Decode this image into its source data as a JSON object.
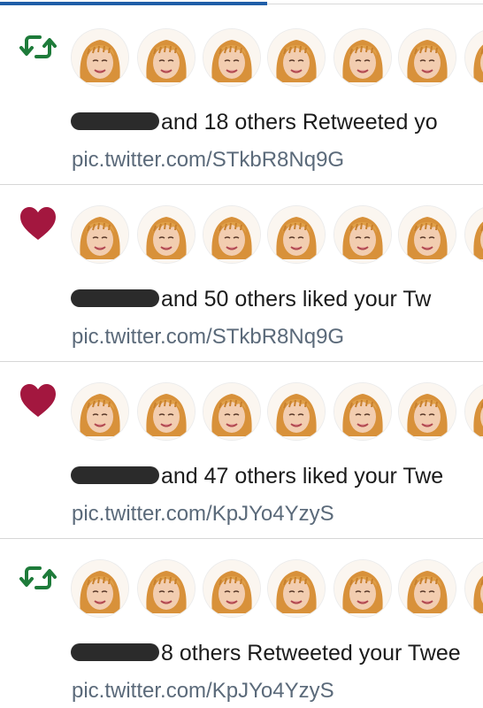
{
  "notifications": [
    {
      "type": "retweet",
      "icon": "retweet-icon",
      "icon_color": "#1e7b3a",
      "summary": "and 18 others Retweeted yo",
      "link": "pic.twitter.com/STkbR8Nq9G",
      "avatar_count": 7
    },
    {
      "type": "like",
      "icon": "heart-icon",
      "icon_color": "#a3173f",
      "summary": "and 50 others liked your Tw",
      "link": "pic.twitter.com/STkbR8Nq9G",
      "avatar_count": 7
    },
    {
      "type": "like",
      "icon": "heart-icon",
      "icon_color": "#a3173f",
      "summary": "and 47 others liked your Twe",
      "link": "pic.twitter.com/KpJYo4YzyS",
      "avatar_count": 7
    },
    {
      "type": "retweet",
      "icon": "retweet-icon",
      "icon_color": "#1e7b3a",
      "summary": "8 others Retweeted your Twee",
      "link": "pic.twitter.com/KpJYo4YzyS",
      "avatar_count": 7
    }
  ],
  "colors": {
    "link": "#5b6a7a",
    "text": "#1b1b1b",
    "tab_indicator": "#1f5ea8"
  }
}
